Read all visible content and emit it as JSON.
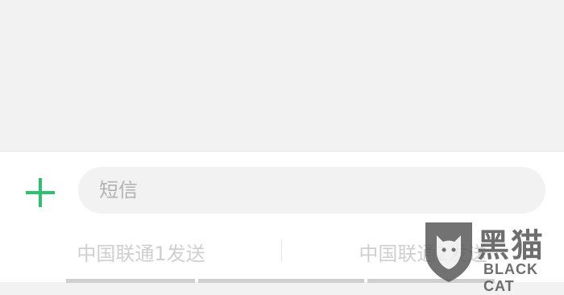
{
  "composer": {
    "input_placeholder": "短信",
    "input_value": ""
  },
  "send_options": [
    {
      "label": "中国联通1发送"
    },
    {
      "label": "中国联通2发送"
    }
  ],
  "icons": {
    "add": "plus-icon"
  },
  "colors": {
    "accent": "#2fbf71",
    "background": "#f2f2f2",
    "panel": "#ffffff",
    "placeholder": "#b2b2b2",
    "send_text": "#cfcfcf"
  },
  "watermark": {
    "chinese": "黑猫",
    "english": "BLACK CAT"
  }
}
